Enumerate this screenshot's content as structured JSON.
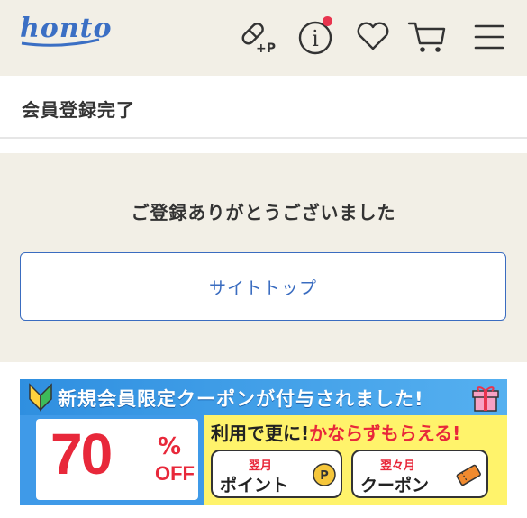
{
  "header": {
    "logo": "honto",
    "icons": [
      "drug-plus-p-icon",
      "info-icon",
      "heart-icon",
      "cart-icon",
      "menu-icon"
    ],
    "point_icon_label": "+P",
    "info_glyph": "i",
    "notification_color": "#e8344e"
  },
  "page": {
    "title": "会員登録完了"
  },
  "main": {
    "message": "ご登録ありがとうございました",
    "top_button_label": "サイトトップ"
  },
  "banner": {
    "headline": "新規会員限定クーポンが付与されました!",
    "discount": "70",
    "percent_sign": "%",
    "off": "OFF",
    "sub_prefix": "利用で更に!",
    "sub_highlight": "かならずもらえる!",
    "pill1_small": "翌月",
    "pill1_big": "ポイント",
    "pill2_small": "翌々月",
    "pill2_big": "クーポン"
  },
  "colors": {
    "accent": "#3a6cc0",
    "header_bg": "#f2efe6",
    "banner_red": "#e8283a",
    "banner_blue": "#3f9ae8",
    "banner_yellow": "#fff36b"
  }
}
